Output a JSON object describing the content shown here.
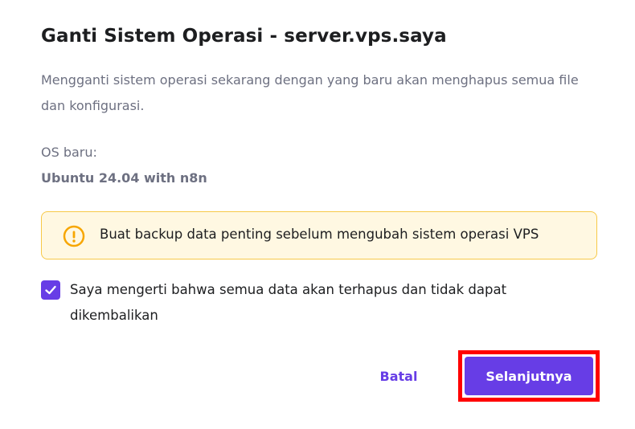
{
  "dialog": {
    "title": "Ganti Sistem Operasi - server.vps.saya",
    "description": "Mengganti sistem operasi sekarang dengan yang baru akan menghapus semua file dan konfigurasi.",
    "os_label": "OS baru:",
    "os_value": "Ubuntu 24.04 with n8n",
    "warning": {
      "icon": "exclamation-circle-icon",
      "text": "Buat backup data penting sebelum mengubah sistem operasi VPS",
      "color": "#f7a600"
    },
    "confirm": {
      "checked": true,
      "label": "Saya mengerti bahwa semua data akan terhapus dan tidak dapat dikembalikan"
    },
    "buttons": {
      "cancel_label": "Batal",
      "next_label": "Selanjutnya"
    },
    "colors": {
      "accent": "#673de6",
      "highlight": "#ff0000",
      "warning_bg": "#fff8e2",
      "warning_border": "#f7c948"
    }
  }
}
